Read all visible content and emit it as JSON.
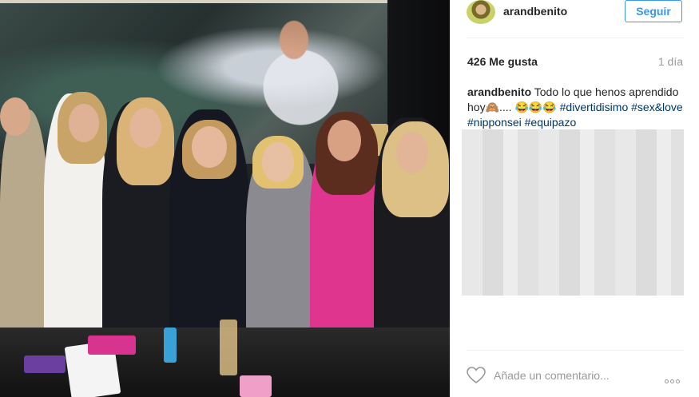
{
  "post": {
    "username": "arandbenito",
    "follow_label": "Seguir",
    "likes": "426 Me gusta",
    "time": "1 día",
    "caption": {
      "user": "arandbenito",
      "text": "Todo lo que henos aprendido hoy🙈.... 😂😂😂",
      "hashtags": [
        "#divertidisimo",
        "#sex&love",
        "#nipponsei",
        "#equipazo"
      ]
    },
    "comment_placeholder": "Añade un comentario..."
  },
  "colors": {
    "accent": "#3897f0",
    "hashtag": "#003569",
    "muted": "#999999"
  },
  "icons": {
    "like": "heart-icon",
    "options": "more-options-icon"
  }
}
